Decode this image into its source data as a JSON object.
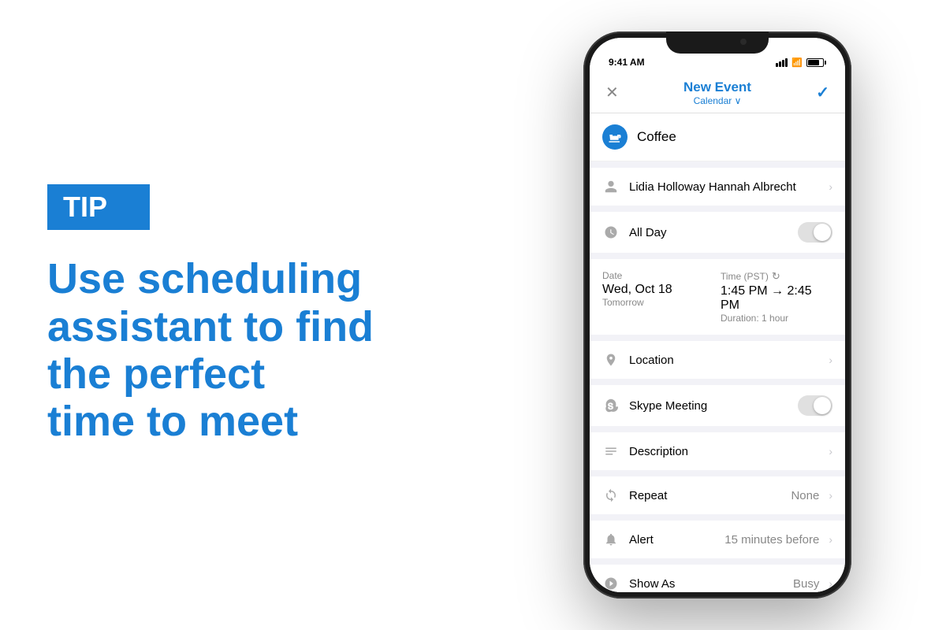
{
  "left": {
    "tip_label": "TIP",
    "headline_line1": "Use scheduling",
    "headline_line2": "assistant to find",
    "headline_line3": "the perfect",
    "headline_line4": "time to meet"
  },
  "phone": {
    "status_bar": {
      "time": "9:41 AM",
      "signal_bars": 4,
      "wifi": true,
      "battery": 80
    },
    "nav": {
      "cancel_icon": "✕",
      "title": "New Event",
      "subtitle": "Calendar ∨",
      "check_icon": "✓"
    },
    "event": {
      "icon": "coffee",
      "title": "Coffee"
    },
    "attendees": {
      "names": "Lidia Holloway   Hannah Albrecht"
    },
    "all_day": {
      "label": "All Day",
      "enabled": false
    },
    "datetime": {
      "date_label": "Date",
      "date_value": "Wed, Oct 18",
      "date_sub": "Tomorrow",
      "time_label": "Time (PST)",
      "time_range": "1:45 PM → 2:45 PM",
      "duration": "Duration: 1 hour"
    },
    "location": {
      "label": "Location"
    },
    "skype": {
      "label": "Skype Meeting",
      "enabled": false
    },
    "description": {
      "label": "Description"
    },
    "repeat": {
      "label": "Repeat",
      "value": "None"
    },
    "alert": {
      "label": "Alert",
      "value": "15 minutes before"
    },
    "show_as": {
      "label": "Show As",
      "value": "Busy"
    }
  }
}
